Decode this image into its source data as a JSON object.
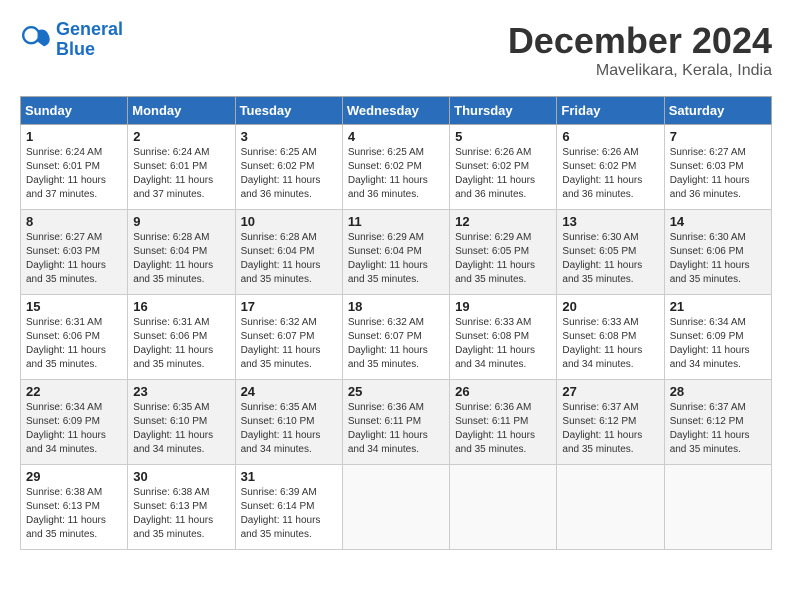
{
  "header": {
    "logo_line1": "General",
    "logo_line2": "Blue",
    "month_year": "December 2024",
    "location": "Mavelikara, Kerala, India"
  },
  "weekdays": [
    "Sunday",
    "Monday",
    "Tuesday",
    "Wednesday",
    "Thursday",
    "Friday",
    "Saturday"
  ],
  "weeks": [
    [
      {
        "day": "1",
        "sunrise": "6:24 AM",
        "sunset": "6:01 PM",
        "daylight": "11 hours and 37 minutes."
      },
      {
        "day": "2",
        "sunrise": "6:24 AM",
        "sunset": "6:01 PM",
        "daylight": "11 hours and 37 minutes."
      },
      {
        "day": "3",
        "sunrise": "6:25 AM",
        "sunset": "6:02 PM",
        "daylight": "11 hours and 36 minutes."
      },
      {
        "day": "4",
        "sunrise": "6:25 AM",
        "sunset": "6:02 PM",
        "daylight": "11 hours and 36 minutes."
      },
      {
        "day": "5",
        "sunrise": "6:26 AM",
        "sunset": "6:02 PM",
        "daylight": "11 hours and 36 minutes."
      },
      {
        "day": "6",
        "sunrise": "6:26 AM",
        "sunset": "6:02 PM",
        "daylight": "11 hours and 36 minutes."
      },
      {
        "day": "7",
        "sunrise": "6:27 AM",
        "sunset": "6:03 PM",
        "daylight": "11 hours and 36 minutes."
      }
    ],
    [
      {
        "day": "8",
        "sunrise": "6:27 AM",
        "sunset": "6:03 PM",
        "daylight": "11 hours and 35 minutes."
      },
      {
        "day": "9",
        "sunrise": "6:28 AM",
        "sunset": "6:04 PM",
        "daylight": "11 hours and 35 minutes."
      },
      {
        "day": "10",
        "sunrise": "6:28 AM",
        "sunset": "6:04 PM",
        "daylight": "11 hours and 35 minutes."
      },
      {
        "day": "11",
        "sunrise": "6:29 AM",
        "sunset": "6:04 PM",
        "daylight": "11 hours and 35 minutes."
      },
      {
        "day": "12",
        "sunrise": "6:29 AM",
        "sunset": "6:05 PM",
        "daylight": "11 hours and 35 minutes."
      },
      {
        "day": "13",
        "sunrise": "6:30 AM",
        "sunset": "6:05 PM",
        "daylight": "11 hours and 35 minutes."
      },
      {
        "day": "14",
        "sunrise": "6:30 AM",
        "sunset": "6:06 PM",
        "daylight": "11 hours and 35 minutes."
      }
    ],
    [
      {
        "day": "15",
        "sunrise": "6:31 AM",
        "sunset": "6:06 PM",
        "daylight": "11 hours and 35 minutes."
      },
      {
        "day": "16",
        "sunrise": "6:31 AM",
        "sunset": "6:06 PM",
        "daylight": "11 hours and 35 minutes."
      },
      {
        "day": "17",
        "sunrise": "6:32 AM",
        "sunset": "6:07 PM",
        "daylight": "11 hours and 35 minutes."
      },
      {
        "day": "18",
        "sunrise": "6:32 AM",
        "sunset": "6:07 PM",
        "daylight": "11 hours and 35 minutes."
      },
      {
        "day": "19",
        "sunrise": "6:33 AM",
        "sunset": "6:08 PM",
        "daylight": "11 hours and 34 minutes."
      },
      {
        "day": "20",
        "sunrise": "6:33 AM",
        "sunset": "6:08 PM",
        "daylight": "11 hours and 34 minutes."
      },
      {
        "day": "21",
        "sunrise": "6:34 AM",
        "sunset": "6:09 PM",
        "daylight": "11 hours and 34 minutes."
      }
    ],
    [
      {
        "day": "22",
        "sunrise": "6:34 AM",
        "sunset": "6:09 PM",
        "daylight": "11 hours and 34 minutes."
      },
      {
        "day": "23",
        "sunrise": "6:35 AM",
        "sunset": "6:10 PM",
        "daylight": "11 hours and 34 minutes."
      },
      {
        "day": "24",
        "sunrise": "6:35 AM",
        "sunset": "6:10 PM",
        "daylight": "11 hours and 34 minutes."
      },
      {
        "day": "25",
        "sunrise": "6:36 AM",
        "sunset": "6:11 PM",
        "daylight": "11 hours and 34 minutes."
      },
      {
        "day": "26",
        "sunrise": "6:36 AM",
        "sunset": "6:11 PM",
        "daylight": "11 hours and 35 minutes."
      },
      {
        "day": "27",
        "sunrise": "6:37 AM",
        "sunset": "6:12 PM",
        "daylight": "11 hours and 35 minutes."
      },
      {
        "day": "28",
        "sunrise": "6:37 AM",
        "sunset": "6:12 PM",
        "daylight": "11 hours and 35 minutes."
      }
    ],
    [
      {
        "day": "29",
        "sunrise": "6:38 AM",
        "sunset": "6:13 PM",
        "daylight": "11 hours and 35 minutes."
      },
      {
        "day": "30",
        "sunrise": "6:38 AM",
        "sunset": "6:13 PM",
        "daylight": "11 hours and 35 minutes."
      },
      {
        "day": "31",
        "sunrise": "6:39 AM",
        "sunset": "6:14 PM",
        "daylight": "11 hours and 35 minutes."
      },
      null,
      null,
      null,
      null
    ]
  ]
}
